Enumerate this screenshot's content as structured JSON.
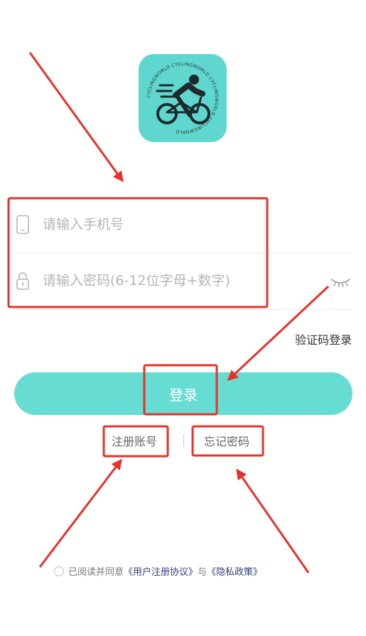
{
  "logo": {
    "icon": "cyclist-icon",
    "ring_text": "CYCLINGWORLD CYCLINGWORLD CYCLINGWORLD CYCLINGWORLD"
  },
  "phone_field": {
    "icon": "phone-icon",
    "placeholder": "请输入手机号",
    "value": ""
  },
  "password_field": {
    "icon": "lock-icon",
    "placeholder": "请输入密码(6-12位字母+数字)",
    "value": "",
    "toggle_icon": "eye-closed-icon"
  },
  "code_login_label": "验证码登录",
  "login_button_label": "登录",
  "links": {
    "register": "注册账号",
    "forgot": "忘记密码"
  },
  "agreement": {
    "prefix": "已阅读并同意",
    "user_agreement": "《用户注册协议》",
    "conjunction": "与",
    "privacy_policy": "《隐私政策》"
  },
  "colors": {
    "accent": "#66dcd2",
    "logo_bg": "#5fd6ce",
    "annotation": "#e8312a",
    "link": "#2f3f75"
  }
}
